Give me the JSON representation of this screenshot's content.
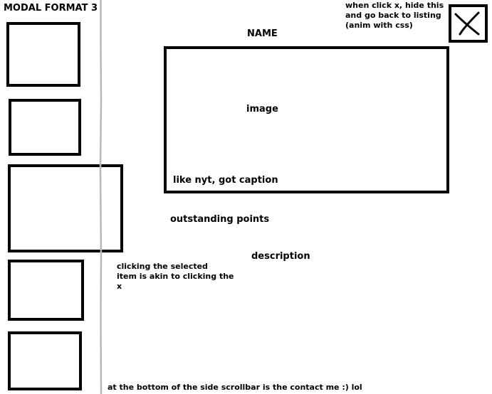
{
  "title": "MODAL FORMAT 3",
  "modal": {
    "name_label": "NAME",
    "image_label": "image",
    "caption": "like nyt, got caption",
    "outstanding_points": "outstanding points",
    "description": "description"
  },
  "close_note": {
    "line1": "when click x, hide this",
    "line2": "and go back to listing",
    "line3": "(anim with css)"
  },
  "sidebar_note": {
    "line1": "clicking the selected",
    "line2": "item is akin to clicking the",
    "line3": "x"
  },
  "footer_note": "at the bottom of the side scrollbar is the contact me :) lol",
  "icons": {
    "close": "close-x-icon"
  }
}
